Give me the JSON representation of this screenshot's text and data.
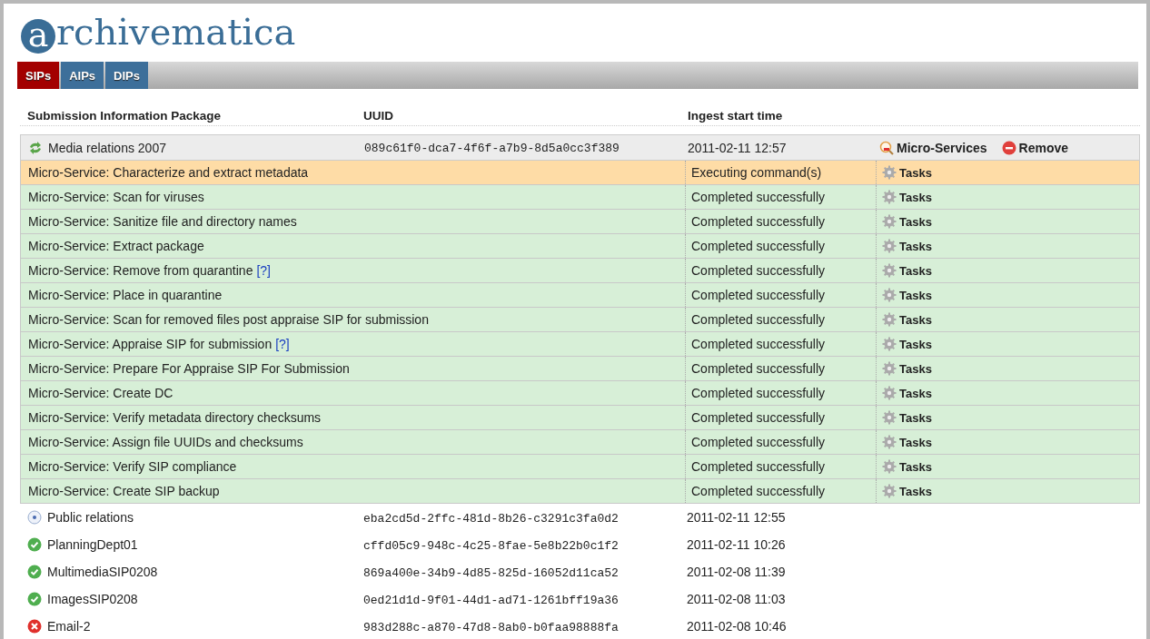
{
  "logo": {
    "text": "archivematica"
  },
  "tabs": [
    {
      "label": "SIPs",
      "selected": true
    },
    {
      "label": "AIPs",
      "selected": false
    },
    {
      "label": "DIPs",
      "selected": false
    }
  ],
  "table": {
    "columns": [
      "Submission Information Package",
      "UUID",
      "Ingest start time"
    ],
    "rows": [
      {
        "name": "Media relations 2007",
        "kind": "processing",
        "uuid": "089c61f0-dca7-4f6f-a7b9-8d5a0cc3f389",
        "time": "2011-02-11 12:57",
        "expanded": true,
        "actions": [
          "Micro-Services",
          "Remove"
        ],
        "micro_services": [
          {
            "name": "Micro-Service: Characterize and extract metadata",
            "kind": "executing",
            "status_text": "Executing command(s)",
            "tasks": "Tasks"
          },
          {
            "name": "Micro-Service: Scan for viruses",
            "kind": "completed",
            "status_text": "Completed successfully",
            "tasks": "Tasks"
          },
          {
            "name": "Micro-Service: Sanitize file and directory names",
            "kind": "completed",
            "status_text": "Completed successfully",
            "tasks": "Tasks"
          },
          {
            "name": "Micro-Service: Extract package",
            "kind": "completed",
            "status_text": "Completed successfully",
            "tasks": "Tasks"
          },
          {
            "name": "Micro-Service: Remove from quarantine",
            "help": "[?]",
            "kind": "completed",
            "status_text": "Completed successfully",
            "tasks": "Tasks"
          },
          {
            "name": "Micro-Service: Place in quarantine",
            "kind": "completed",
            "status_text": "Completed successfully",
            "tasks": "Tasks"
          },
          {
            "name": "Micro-Service: Scan for removed files post appraise SIP for submission",
            "kind": "completed",
            "status_text": "Completed successfully",
            "tasks": "Tasks"
          },
          {
            "name": "Micro-Service: Appraise SIP for submission",
            "help": "[?]",
            "kind": "completed",
            "status_text": "Completed successfully",
            "tasks": "Tasks"
          },
          {
            "name": "Micro-Service: Prepare For Appraise SIP For Submission",
            "kind": "completed",
            "status_text": "Completed successfully",
            "tasks": "Tasks"
          },
          {
            "name": "Micro-Service: Create DC",
            "kind": "completed",
            "status_text": "Completed successfully",
            "tasks": "Tasks"
          },
          {
            "name": "Micro-Service: Verify metadata directory checksums",
            "kind": "completed",
            "status_text": "Completed successfully",
            "tasks": "Tasks"
          },
          {
            "name": "Micro-Service: Assign file UUIDs and checksums",
            "kind": "completed",
            "status_text": "Completed successfully",
            "tasks": "Tasks"
          },
          {
            "name": "Micro-Service: Verify SIP compliance",
            "kind": "completed",
            "status_text": "Completed successfully",
            "tasks": "Tasks"
          },
          {
            "name": "Micro-Service: Create SIP backup",
            "kind": "completed",
            "status_text": "Completed successfully",
            "tasks": "Tasks"
          }
        ]
      },
      {
        "name": "Public relations",
        "kind": "pending",
        "uuid": "eba2cd5d-2ffc-481d-8b26-c3291c3fa0d2",
        "time": "2011-02-11 12:55",
        "expanded": false
      },
      {
        "name": "PlanningDept01",
        "kind": "done",
        "uuid": "cffd05c9-948c-4c25-8fae-5e8b22b0c1f2",
        "time": "2011-02-11 10:26",
        "expanded": false
      },
      {
        "name": "MultimediaSIP0208",
        "kind": "done",
        "uuid": "869a400e-34b9-4d85-825d-16052d11ca52",
        "time": "2011-02-08 11:39",
        "expanded": false
      },
      {
        "name": "ImagesSIP0208",
        "kind": "done",
        "uuid": "0ed21d1d-9f01-44d1-ad71-1261bff19a36",
        "time": "2011-02-08 11:03",
        "expanded": false
      },
      {
        "name": "Email-2",
        "kind": "failed",
        "uuid": "983d288c-a870-47d8-8ab0-b0faa98888fa",
        "time": "2011-02-08 10:46",
        "expanded": false
      }
    ]
  }
}
